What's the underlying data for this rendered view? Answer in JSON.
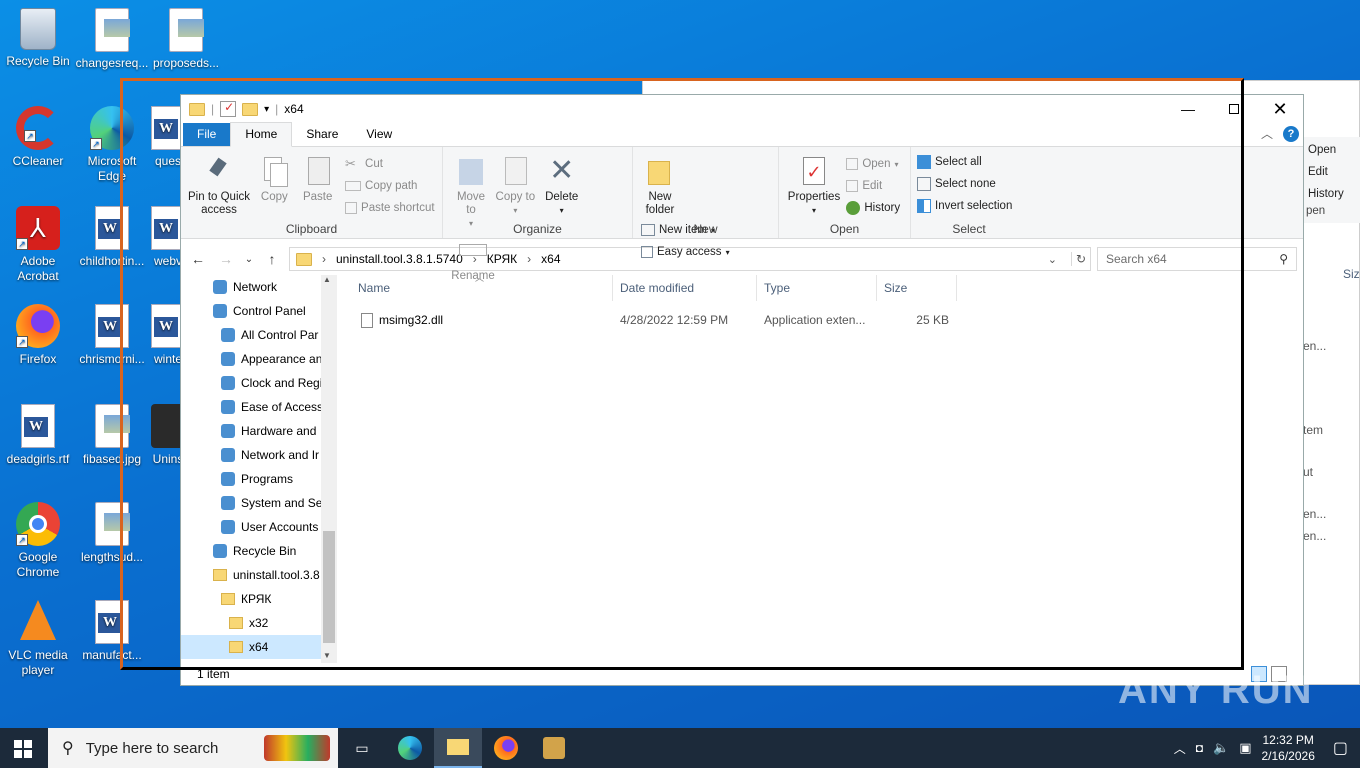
{
  "desktop": {
    "icons": [
      {
        "label": "Recycle Bin"
      },
      {
        "label": "changesreq..."
      },
      {
        "label": "proposeds..."
      },
      {
        "label": "CCleaner"
      },
      {
        "label": "Microsoft Edge"
      },
      {
        "label": "ques"
      },
      {
        "label": "Adobe Acrobat"
      },
      {
        "label": "childhortin..."
      },
      {
        "label": "webv"
      },
      {
        "label": "Firefox"
      },
      {
        "label": "chrismorni..."
      },
      {
        "label": "winte"
      },
      {
        "label": "deadgirls.rtf"
      },
      {
        "label": "fibased.jpg"
      },
      {
        "label": "Unins"
      },
      {
        "label": "Google Chrome"
      },
      {
        "label": "lengthsud..."
      },
      {
        "label": "VLC media player"
      },
      {
        "label": "manufact..."
      }
    ]
  },
  "bg_window": {
    "ribbon_items": [
      "Open",
      "Edit",
      "History"
    ],
    "group_label": "pen",
    "col_label": "Size",
    "rows": [
      "en...",
      "tem",
      "ut",
      "en...",
      "en..."
    ]
  },
  "window": {
    "title": "x64",
    "tabs": {
      "file": "File",
      "home": "Home",
      "share": "Share",
      "view": "View"
    },
    "clipboard": {
      "pin": "Pin to Quick access",
      "copy": "Copy",
      "paste": "Paste",
      "cut": "Cut",
      "copy_path": "Copy path",
      "paste_shortcut": "Paste shortcut",
      "group": "Clipboard"
    },
    "organize": {
      "move": "Move to",
      "copy": "Copy to",
      "delete": "Delete",
      "rename": "Rename",
      "group": "Organize"
    },
    "new": {
      "new_folder": "New folder",
      "new_item": "New item",
      "easy_access": "Easy access",
      "group": "New"
    },
    "open": {
      "properties": "Properties",
      "open": "Open",
      "edit": "Edit",
      "history": "History",
      "group": "Open"
    },
    "select": {
      "all": "Select all",
      "none": "Select none",
      "invert": "Invert selection",
      "group": "Select"
    },
    "address": {
      "crumbs": [
        "uninstall.tool.3.8.1.5740",
        "КРЯК",
        "x64"
      ]
    },
    "search": {
      "placeholder": "Search x64"
    },
    "nav": [
      {
        "label": "Network",
        "indent": 0
      },
      {
        "label": "Control Panel",
        "indent": 0
      },
      {
        "label": "All Control Par",
        "indent": 1
      },
      {
        "label": "Appearance an",
        "indent": 1
      },
      {
        "label": "Clock and Regi",
        "indent": 1
      },
      {
        "label": "Ease of Access",
        "indent": 1
      },
      {
        "label": "Hardware and",
        "indent": 1
      },
      {
        "label": "Network and Ir",
        "indent": 1
      },
      {
        "label": "Programs",
        "indent": 1
      },
      {
        "label": "System and Sec",
        "indent": 1
      },
      {
        "label": "User Accounts",
        "indent": 1
      },
      {
        "label": "Recycle Bin",
        "indent": 0
      },
      {
        "label": "uninstall.tool.3.8",
        "indent": 0
      },
      {
        "label": "КРЯК",
        "indent": 1
      },
      {
        "label": "x32",
        "indent": 2
      },
      {
        "label": "x64",
        "indent": 2
      }
    ],
    "columns": {
      "name": "Name",
      "date": "Date modified",
      "type": "Type",
      "size": "Size"
    },
    "files": [
      {
        "name": "msimg32.dll",
        "date": "4/28/2022 12:59 PM",
        "type": "Application exten...",
        "size": "25 KB"
      }
    ],
    "status": "1 item"
  },
  "taskbar": {
    "search_placeholder": "Type here to search",
    "time": "12:32 PM",
    "date": "2/16/2026"
  },
  "watermark": "ANY RUN",
  "colors": {
    "accent": "#1979ca",
    "highlight": "#d8641f",
    "selection": "#cce8ff"
  }
}
